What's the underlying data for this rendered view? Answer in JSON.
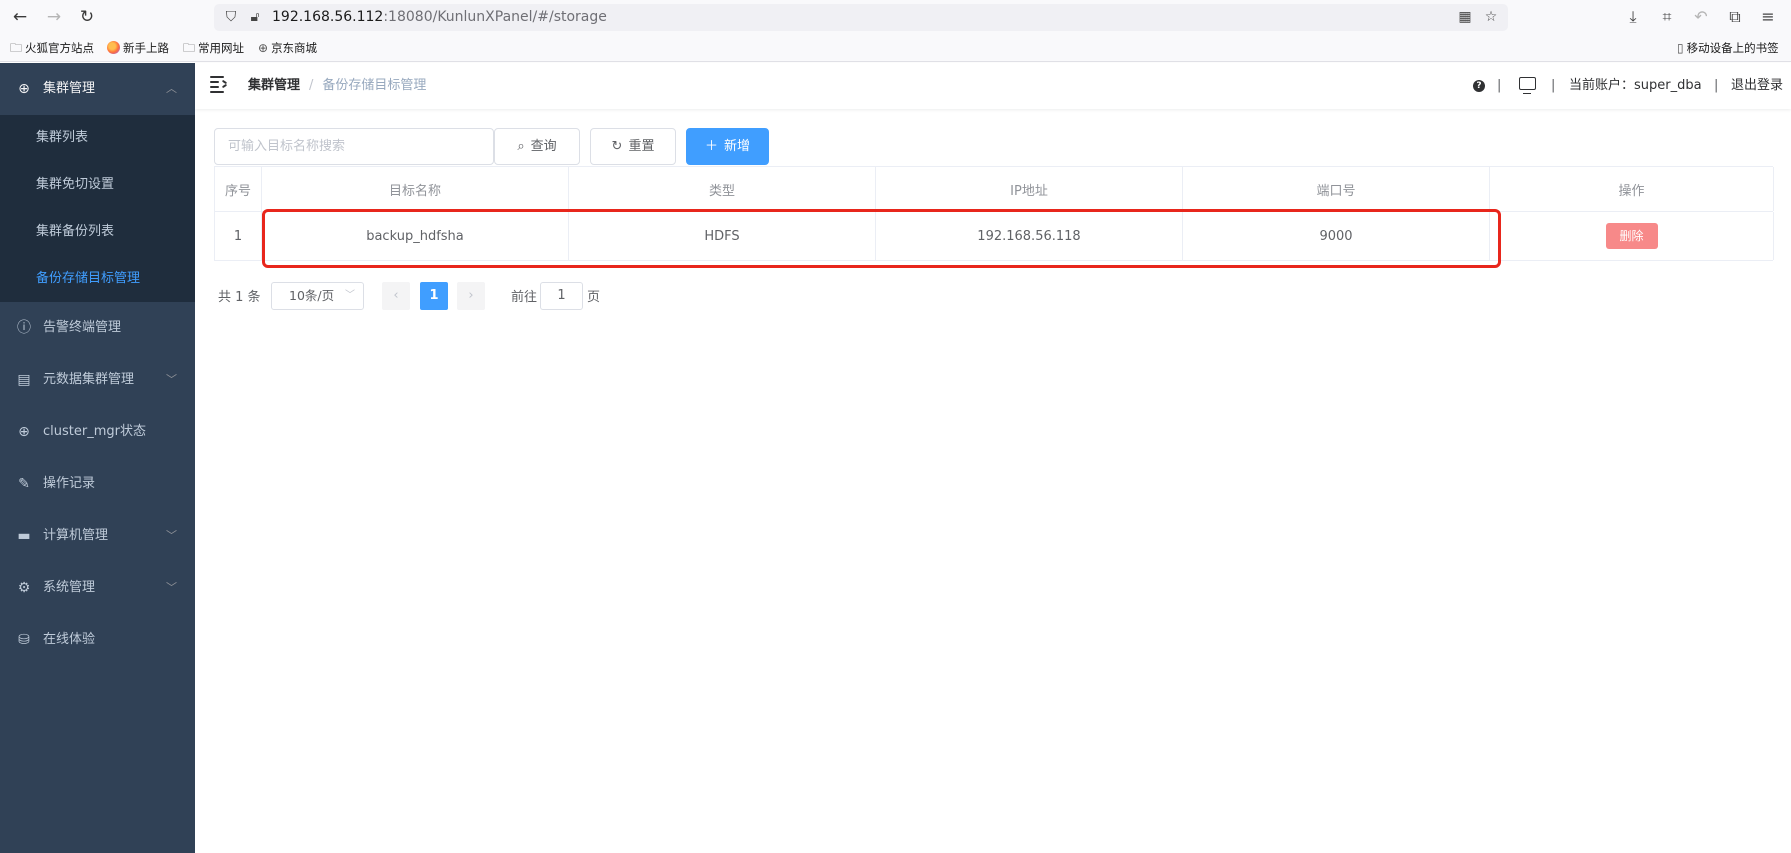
{
  "browser": {
    "url_host": "192.168.56.112",
    "url_rest": ":18080/KunlunXPanel/#/storage",
    "bookmarks": [
      "火狐官方站点",
      "新手上路",
      "常用网址",
      "京东商城"
    ],
    "mobile_bookmarks": "移动设备上的书签"
  },
  "sidebar": {
    "group_open": {
      "label": "集群管理",
      "icon": "plus-circle-icon"
    },
    "sub_items": [
      "集群列表",
      "集群免切设置",
      "集群备份列表",
      "备份存储目标管理"
    ],
    "active_sub": "备份存储目标管理",
    "items": [
      {
        "label": "告警终端管理",
        "icon": "alert-circle-icon",
        "expandable": false
      },
      {
        "label": "元数据集群管理",
        "icon": "chart-box-icon",
        "expandable": true
      },
      {
        "label": "cluster_mgr状态",
        "icon": "crosshair-icon",
        "expandable": false
      },
      {
        "label": "操作记录",
        "icon": "document-edit-icon",
        "expandable": false
      },
      {
        "label": "计算机管理",
        "icon": "monitor-icon",
        "expandable": true
      },
      {
        "label": "系统管理",
        "icon": "gear-icon",
        "expandable": true
      },
      {
        "label": "在线体验",
        "icon": "database-icon",
        "expandable": false
      }
    ]
  },
  "header": {
    "breadcrumb": [
      "集群管理",
      "备份存储目标管理"
    ],
    "account_label": "当前账户：super_dba",
    "logout": "退出登录"
  },
  "toolbar": {
    "search_placeholder": "可输入目标名称搜索",
    "query_label": "查询",
    "reset_label": "重置",
    "add_label": "新增"
  },
  "table": {
    "columns": [
      "序号",
      "目标名称",
      "类型",
      "IP地址",
      "端口号",
      "操作"
    ],
    "rows": [
      {
        "index": "1",
        "name": "backup_hdfsha",
        "type": "HDFS",
        "ip": "192.168.56.118",
        "port": "9000",
        "action": "删除"
      }
    ]
  },
  "pagination": {
    "total": "共 1 条",
    "page_size": "10条/页",
    "current_page": "1",
    "goto_label": "前往",
    "goto_value": "1",
    "page_suffix": "页"
  },
  "colors": {
    "primary": "#409eff",
    "danger": "#f78989",
    "sidebar": "#304156",
    "highlight": "#e8261c"
  }
}
